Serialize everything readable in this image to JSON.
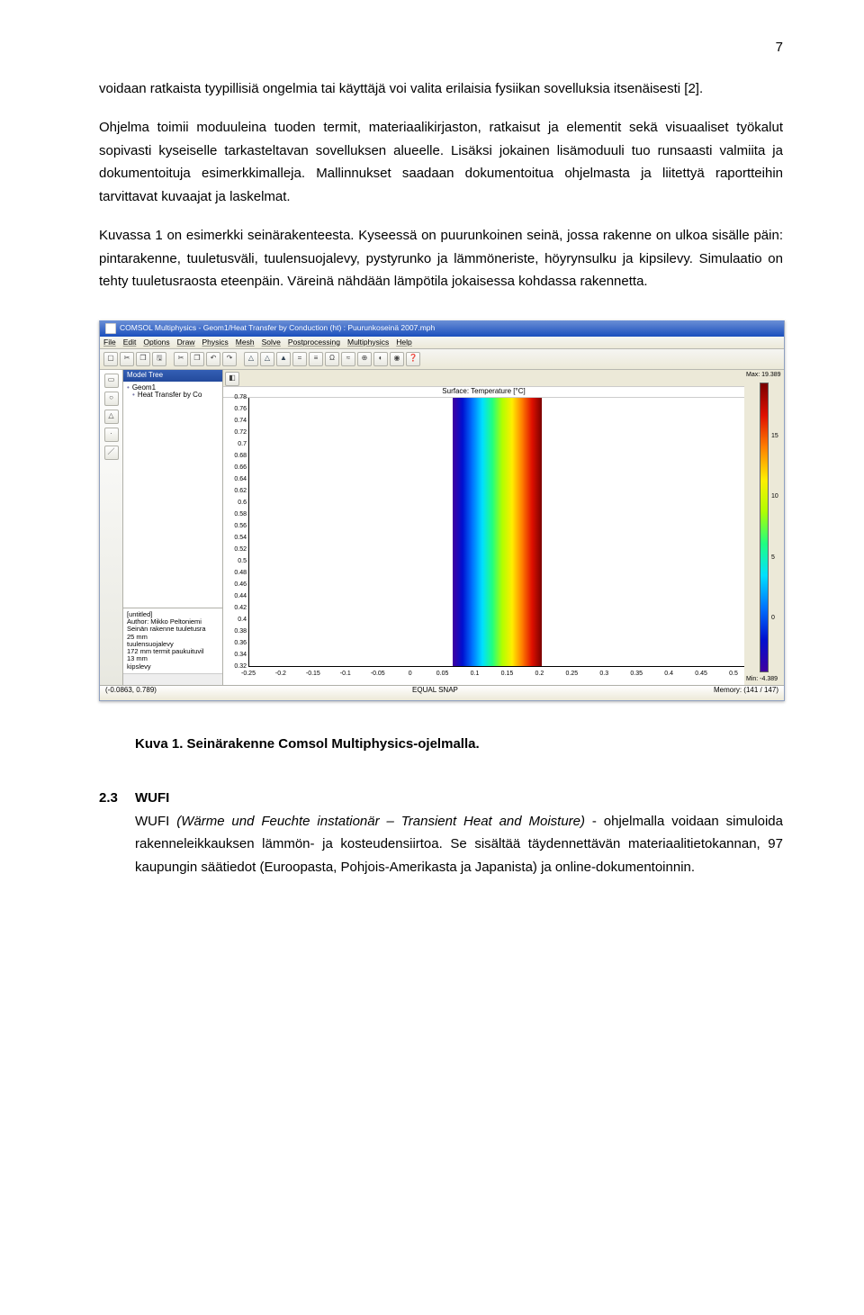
{
  "page_number": "7",
  "para1": "voidaan ratkaista tyypillisiä ongelmia tai käyttäjä voi valita erilaisia fysiikan sovelluksia itsenäisesti [2].",
  "para2": "Ohjelma toimii moduuleina tuoden termit, materiaalikirjaston, ratkaisut ja elementit sekä visuaaliset työkalut sopivasti kyseiselle tarkasteltavan sovelluksen alueelle. Lisäksi jokainen lisämoduuli tuo runsaasti valmiita ja dokumentoituja esimerkkimalleja. Mallinnukset saadaan dokumentoitua ohjelmasta ja liitettyä raportteihin tarvittavat kuvaajat ja laskelmat.",
  "para3": "Kuvassa 1 on esimerkki seinärakenteesta. Kyseessä on puurunkoinen seinä, jossa rakenne on ulkoa sisälle päin: pintarakenne, tuuletusväli, tuulensuojalevy, pystyrunko ja lämmöneriste, höyrynsulku ja kipsilevy. Simulaatio on tehty tuuletusraosta eteenpäin. Väreinä nähdään lämpötila jokaisessa kohdassa rakennetta.",
  "figcaption": "Kuva 1. Seinärakenne Comsol Multiphysics-ojelmalla.",
  "section_num": "2.3",
  "section_title": "WUFI",
  "para4_prefix": "WUFI ",
  "para4_italic": "(Wärme und Feuchte instationär – Transient Heat and Moisture)",
  "para4_rest": " - ohjelmalla voidaan simuloida rakenneleikkauksen lämmön- ja kosteudensiirtoa. Se sisältää täydennettävän materiaalitietokannan, 97 kaupungin säätiedot (Euroopasta, Pohjois-Amerikasta ja Japanista) ja online-dokumentoinnin.",
  "comsol": {
    "title": "COMSOL Multiphysics - Geom1/Heat Transfer by Conduction (ht) : Puurunkoseinä 2007.mph",
    "menus": [
      "File",
      "Edit",
      "Options",
      "Draw",
      "Physics",
      "Mesh",
      "Solve",
      "Postprocessing",
      "Multiphysics",
      "Help"
    ],
    "surface_label": "Surface: Temperature [°C]",
    "tree_items": [
      "Geom1",
      "  Heat Transfer by Co"
    ],
    "tree_head": "Model Tree",
    "info_box": "[untitled]\nAuthor: Mikko Peltoniemi\nSeinän rakenne tuuletusra\n25 mm\ntuulensuojalevy\n172 mm termit paukuituvil\n13 mm\nkipslevy",
    "status_left": "(-0.0863, 0.789)",
    "status_mid": "EQUAL   SNAP",
    "status_right": "Memory: (141 / 147)",
    "max_label": "Max: 19.389",
    "min_label": "Min: -4.389"
  },
  "chart_data": {
    "type": "heatmap",
    "title": "Surface: Temperature [°C]",
    "xlabel": "",
    "ylabel": "",
    "x_ticks": [
      -0.25,
      -0.2,
      -0.15,
      -0.1,
      -0.05,
      0,
      0.05,
      0.1,
      0.15,
      0.2,
      0.25,
      0.3,
      0.35,
      0.4,
      0.45,
      0.5
    ],
    "y_ticks": [
      0.78,
      0.76,
      0.74,
      0.72,
      0.7,
      0.68,
      0.66,
      0.64,
      0.62,
      0.6,
      0.58,
      0.56,
      0.54,
      0.52,
      0.5,
      0.48,
      0.46,
      0.44,
      0.42,
      0.4,
      0.38,
      0.36,
      0.34,
      0.32
    ],
    "xlim": [
      -0.25,
      0.5
    ],
    "ylim": [
      0.32,
      0.78
    ],
    "colorbar": {
      "ticks": [
        15,
        10,
        5,
        0
      ],
      "max": 19.389,
      "min": -4.389,
      "unit": "°C"
    }
  }
}
